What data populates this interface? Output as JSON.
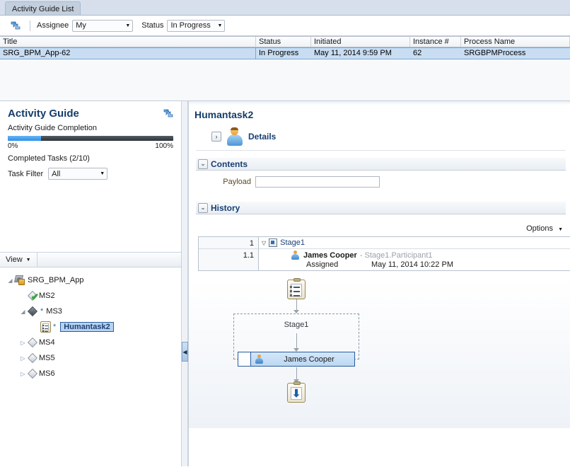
{
  "tab": {
    "label": "Activity Guide List"
  },
  "toolbar": {
    "refresh_icon": "refresh-icon",
    "assignee_label": "Assignee",
    "assignee_value": "My",
    "status_label": "Status",
    "status_value": "In Progress"
  },
  "master_table": {
    "columns": [
      "Title",
      "Status",
      "Initiated",
      "Instance #",
      "Process Name"
    ],
    "rows": [
      {
        "title": "SRG_BPM_App-62",
        "status": "In Progress",
        "initiated": "May 11, 2014 9:59 PM",
        "instance": "62",
        "process_name": "SRGBPMProcess"
      }
    ]
  },
  "activity_guide": {
    "title": "Activity Guide",
    "refresh_icon": "refresh-icon",
    "completion_label": "Activity Guide Completion",
    "progress_min_label": "0%",
    "progress_max_label": "100%",
    "progress_percent": 20,
    "completed_tasks_label": "Completed Tasks",
    "completed_tasks_value": "(2/10)",
    "task_filter_label": "Task Filter",
    "task_filter_value": "All"
  },
  "tree_panel": {
    "view_menu": "View",
    "nodes": [
      {
        "label": "SRG_BPM_App",
        "icon": "application-icon",
        "twisty": "expanded",
        "indent": 0,
        "selected": false,
        "star": false
      },
      {
        "label": "MS2",
        "icon": "milestone-complete-icon",
        "twisty": "none",
        "indent": 1,
        "selected": false,
        "star": false
      },
      {
        "label": "MS3",
        "icon": "milestone-active-icon",
        "twisty": "expanded",
        "indent": 1,
        "selected": false,
        "star": true
      },
      {
        "label": "Humantask2",
        "icon": "task-icon",
        "twisty": "none",
        "indent": 2,
        "selected": true,
        "star": true
      },
      {
        "label": "MS4",
        "icon": "milestone-icon",
        "twisty": "collapsed",
        "indent": 1,
        "selected": false,
        "star": false
      },
      {
        "label": "MS5",
        "icon": "milestone-icon",
        "twisty": "collapsed",
        "indent": 1,
        "selected": false,
        "star": false
      },
      {
        "label": "MS6",
        "icon": "milestone-icon",
        "twisty": "collapsed",
        "indent": 1,
        "selected": false,
        "star": false
      }
    ]
  },
  "detail": {
    "title": "Humantask2",
    "details_label": "Details",
    "details_expand_glyph": "›",
    "contents_label": "Contents",
    "payload_label": "Payload",
    "payload_value": "",
    "history_label": "History",
    "options_label": "Options"
  },
  "history_table": {
    "rows": [
      {
        "number": "1",
        "type": "stage",
        "label": "Stage1",
        "twisty": "▽",
        "icon": "stage-icon"
      },
      {
        "number": "1.1",
        "type": "participant",
        "name": "James Cooper",
        "role": "- Stage1.Participant1",
        "state": "Assigned",
        "timestamp": "May 11, 2014 10:22 PM",
        "icon": "person-icon"
      }
    ]
  },
  "flow_diagram": {
    "start_icon": "task-start-icon",
    "stage_label": "Stage1",
    "participant_label": "James Cooper",
    "participant_icon": "person-icon",
    "end_icon": "task-submit-icon"
  },
  "splitter": {
    "collapse_glyph": "◀"
  },
  "colors": {
    "accent": "#153c6b",
    "selection": "#c9ddf2",
    "progress_fill": "#2f8fe8",
    "tab_bg": "#c3cfdd"
  }
}
